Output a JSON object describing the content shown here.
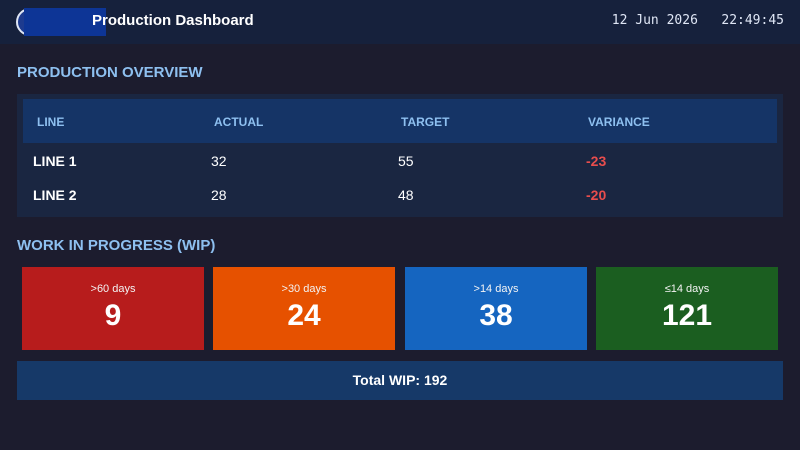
{
  "header": {
    "title": "Production Dashboard",
    "date": "12 Jun 2026",
    "time": "22:49:45",
    "logo_icon": "company-logo-icon"
  },
  "production": {
    "section_title": "PRODUCTION OVERVIEW",
    "columns": [
      "LINE",
      "ACTUAL",
      "TARGET",
      "VARIANCE"
    ],
    "rows": [
      {
        "line": "LINE 1",
        "actual": "32",
        "target": "55",
        "variance": "-23"
      },
      {
        "line": "LINE 2",
        "actual": "28",
        "target": "48",
        "variance": "-20"
      }
    ]
  },
  "wip": {
    "section_title": "WORK IN PROGRESS (WIP)",
    "cards": [
      {
        "label": ">60 days",
        "value": "9",
        "color": "#b71c1c"
      },
      {
        "label": ">30 days",
        "value": "24",
        "color": "#e65100"
      },
      {
        "label": ">14 days",
        "value": "38",
        "color": "#1565c0"
      },
      {
        "label": "≤14 days",
        "value": "121",
        "color": "#1b5e20"
      }
    ],
    "total_label": "Total WIP: 192"
  },
  "colors": {
    "background": "#1c1c2e",
    "header_bg": "#16213c",
    "accent_text": "#8ec0f0",
    "negative": "#e84d4d"
  }
}
